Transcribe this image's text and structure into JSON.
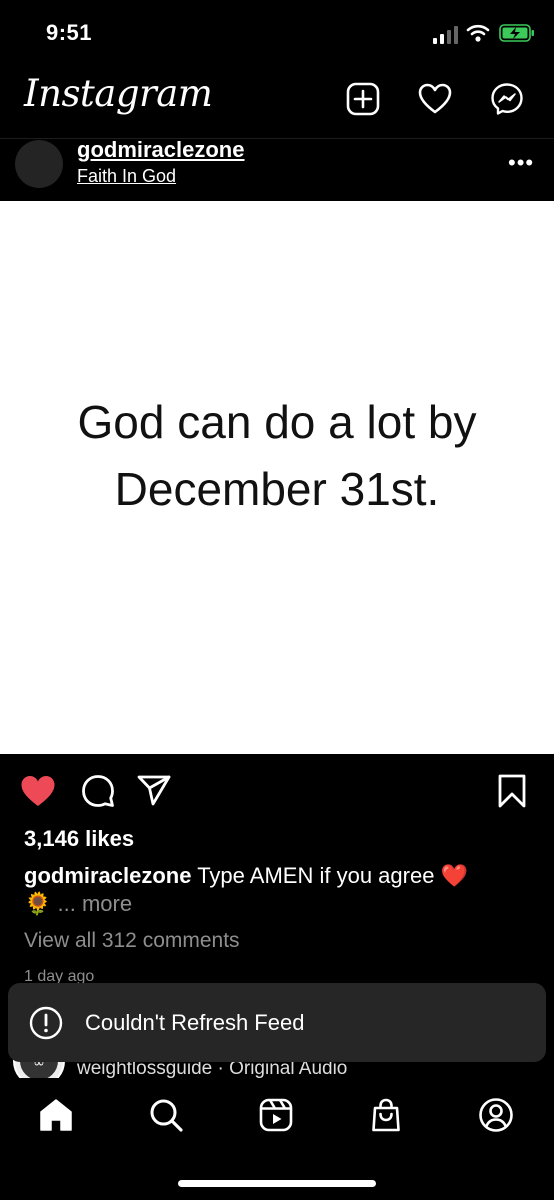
{
  "status_bar": {
    "time": "9:51"
  },
  "header": {
    "logo": "Instagram"
  },
  "post": {
    "username": "godmiraclezone",
    "subtitle": "Faith In God",
    "more": "•••",
    "image_text": [
      "God can do a lot by",
      "December 31st."
    ],
    "likes": "3,146 likes",
    "caption_user": "godmiraclezone",
    "caption_text": " Type AMEN if you agree ❤️",
    "caption_emoji": "🌻",
    "caption_more": " ... more",
    "view_comments": "View all 312 comments",
    "time_ago": "1 day ago",
    "like_color": "#ed4956"
  },
  "toast": {
    "icon": "alert-circle-icon",
    "message": "Couldn't Refresh Feed"
  },
  "next_post": {
    "username": "weightlossguide",
    "audio": "weightlossguide · Original Audio"
  },
  "tabs": [
    "home-icon",
    "search-icon",
    "reels-icon",
    "shop-icon",
    "profile-icon"
  ]
}
